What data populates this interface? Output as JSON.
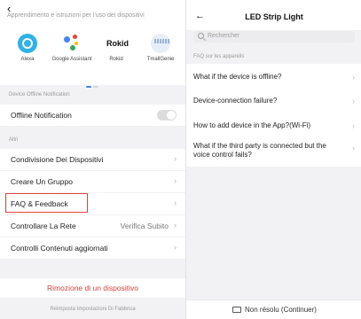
{
  "left": {
    "back_icon": "‹",
    "subtitle": "Apprendimento e istruzioni per l'uso dei dispositivi",
    "assistants": [
      {
        "label": "Alexa",
        "icon": "alexa-icon"
      },
      {
        "label": "Google Assistant",
        "icon": "google-assistant-icon"
      },
      {
        "label": "Rokid",
        "icon": "rokid-icon"
      },
      {
        "label": "TmallGenie",
        "icon": "tmallgenie-icon"
      }
    ],
    "rokid_logo": "Rokid",
    "offline_section": "Device Offline Notification",
    "offline_label": "Offline Notification",
    "altri_section": "Altri",
    "items": {
      "share": "Condivisione Dei Dispositivi",
      "group": "Creare Un Gruppo",
      "faq": "FAQ & Feedback",
      "network": "Controllare La Rete",
      "network_value": "Verifica Subito",
      "updates": "Controlli Contenuti aggiornati"
    },
    "remove": "Rimozione di un dispositivo",
    "reset": "Reimposta Impostazioni Di Fabbrica",
    "colors": {
      "danger": "#e0443a",
      "accent": "#4a86e8"
    }
  },
  "right": {
    "back_icon": "←",
    "title": "LED Strip Light",
    "search_placeholder": "Rechercher",
    "section": "FAQ sur les appareils",
    "faqs": [
      "What if the device is offline?",
      "Device-connection failure?",
      "How to add device in the App?(Wi-Fi)",
      "What if the third party is connected but the voice control fails?"
    ],
    "bottom": "Non résolu (Continuer)"
  }
}
